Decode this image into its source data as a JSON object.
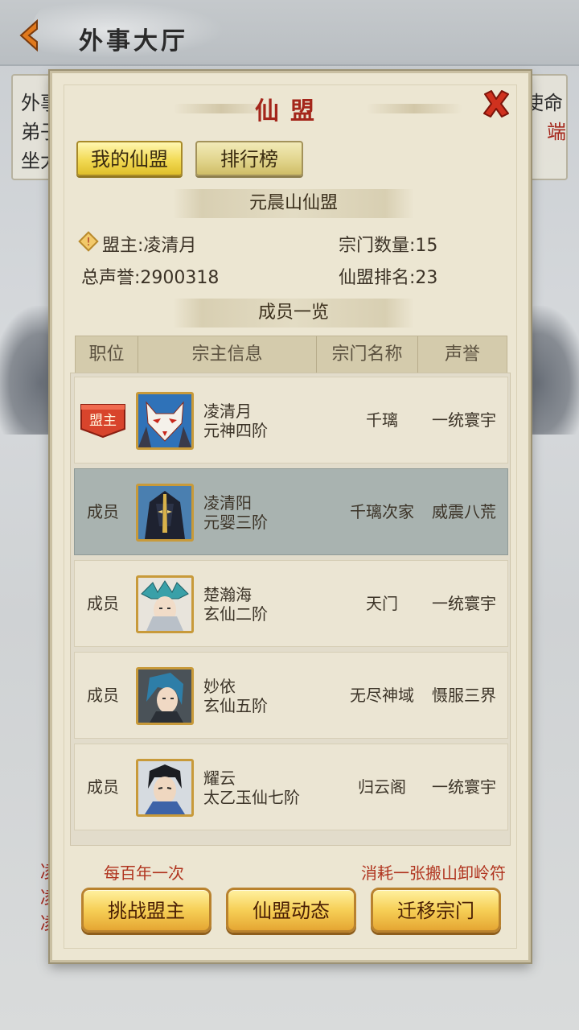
{
  "header": {
    "title": "外事大厅"
  },
  "background_notice": {
    "lines": [
      "外事",
      "弟子",
      "坐大"
    ],
    "right_lines": [
      "使命",
      "端"
    ],
    "bottom_chars": [
      "凌",
      "凌",
      "凌"
    ]
  },
  "dialog": {
    "title": "仙盟",
    "tabs": [
      "我的仙盟",
      "排行榜"
    ],
    "alliance_name": "元晨山仙盟",
    "leader": "盟主:凌清月",
    "sect_count": "宗门数量:15",
    "total_reputation": "总声誉:2900318",
    "alliance_rank": "仙盟排名:23",
    "members_title": "成员一览",
    "columns": [
      "职位",
      "宗主信息",
      "宗门名称",
      "声誉"
    ],
    "rows": [
      {
        "position": "盟主",
        "name": "凌清月",
        "rank": "元神四阶",
        "sect": "千璃",
        "reputation": "一统寰宇",
        "highlight": false
      },
      {
        "position": "成员",
        "name": "凌清阳",
        "rank": "元婴三阶",
        "sect": "千璃次家",
        "reputation": "威震八荒",
        "highlight": true
      },
      {
        "position": "成员",
        "name": "楚瀚海",
        "rank": "玄仙二阶",
        "sect": "天门",
        "reputation": "一统寰宇",
        "highlight": false
      },
      {
        "position": "成员",
        "name": "妙依",
        "rank": "玄仙五阶",
        "sect": "无尽神域",
        "reputation": "慑服三界",
        "highlight": false
      },
      {
        "position": "成员",
        "name": "耀云",
        "rank": "太乙玉仙七阶",
        "sect": "归云阁",
        "reputation": "一统寰宇",
        "highlight": false
      }
    ],
    "note_left": "每百年一次",
    "note_right": "消耗一张搬山卸岭符",
    "buttons": [
      "挑战盟主",
      "仙盟动态",
      "迁移宗门"
    ]
  },
  "colors": {
    "accent_red": "#a4261b",
    "gold": "#f2da55",
    "highlight_row": "#a9b3b0"
  }
}
